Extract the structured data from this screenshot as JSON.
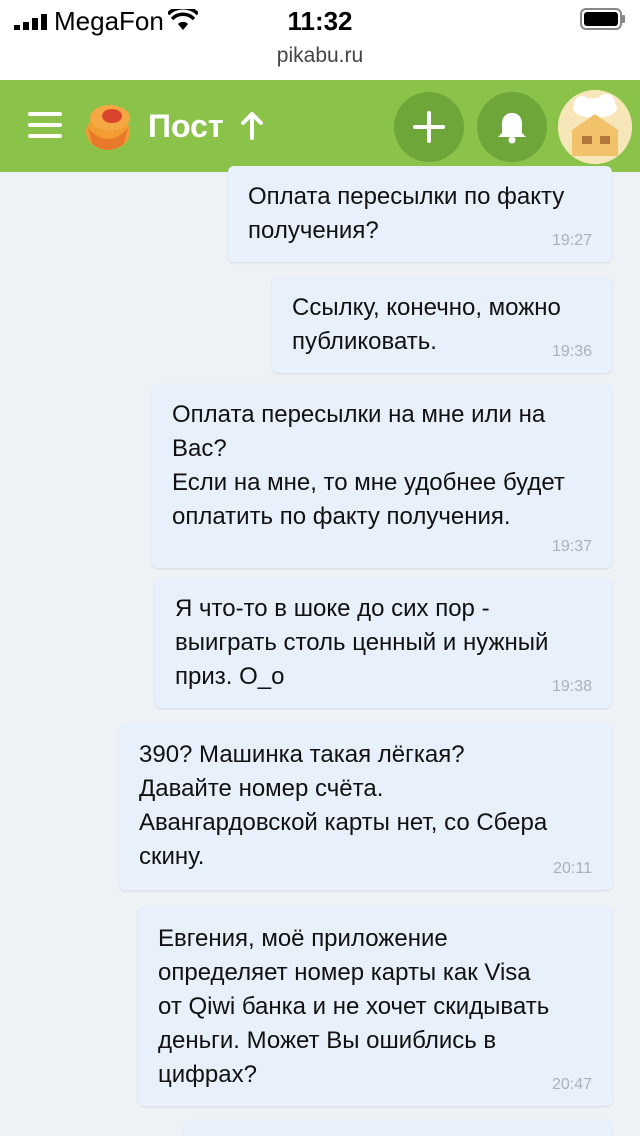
{
  "status_bar": {
    "carrier": "MegaFon",
    "time": "11:32",
    "url": "pikabu.ru"
  },
  "header": {
    "title": "Пост",
    "icons": [
      "menu-icon",
      "pikabu-logo",
      "arrow-up-icon",
      "plus-icon",
      "bell-icon",
      "avatar"
    ]
  },
  "colors": {
    "header_bg": "#8bc34a",
    "header_button_bg": "#6ea63a",
    "message_bg": "#e8f0fb",
    "page_bg": "#eef2f7"
  },
  "messages": [
    {
      "text": "Оплата пересылки по факту\nполучения?",
      "time": "19:27"
    },
    {
      "text": "Ссылку, конечно, можно\nпубликовать.",
      "time": "19:36"
    },
    {
      "text": "Оплата пересылки на мне или на\nВас?\nЕсли на мне, то мне удобнее будет\nоплатить по факту получения.",
      "time": "19:37"
    },
    {
      "text": "Я что-то в шоке до сих пор -\nвыиграть столь ценный и нужный\nприз. О_о",
      "time": "19:38"
    },
    {
      "text": "390? Машинка такая лёгкая?\nДавайте номер счёта.\nАвангардовской карты нет, со Сбера\nскину.",
      "time": "20:11"
    },
    {
      "text": "Евгения, моё приложение\nопределяет номер карты как Visa\nот Qiwi банка и не хочет скидывать\nденьги. Может Вы ошиблись в\nцифрах?",
      "time": "20:47"
    }
  ]
}
